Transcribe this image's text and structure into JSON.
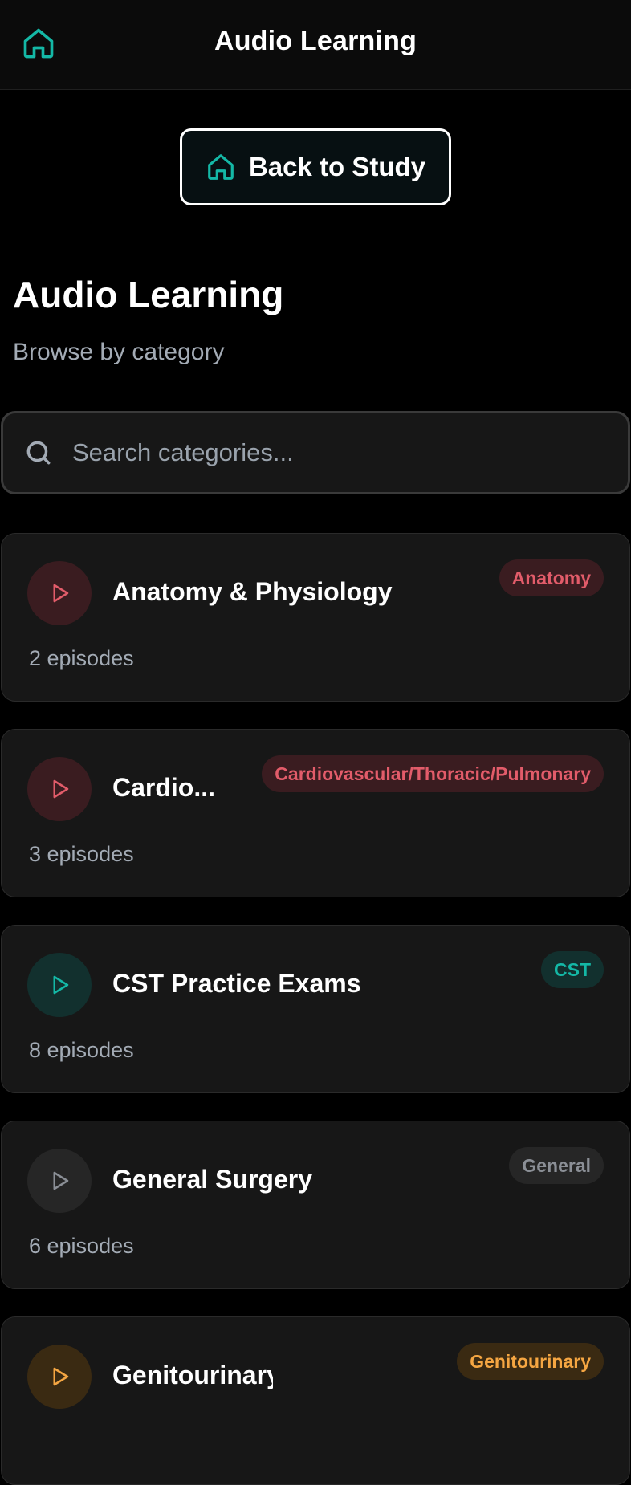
{
  "header": {
    "title": "Audio Learning",
    "home_icon": "home-icon"
  },
  "back_button": {
    "label": "Back to Study",
    "icon": "home-icon"
  },
  "page": {
    "title": "Audio Learning",
    "subtitle": "Browse by category"
  },
  "search": {
    "placeholder": "Search categories...",
    "value": ""
  },
  "colors": {
    "accent_teal": "#14b8a6",
    "red": "#e25c6a",
    "gray": "#8b8f96",
    "orange": "#f5a642",
    "card_bg": "#171717"
  },
  "categories": [
    {
      "name": "Anatomy & Physiology",
      "episodes": "2 episodes",
      "badge": "Anatomy",
      "tone": "red"
    },
    {
      "name": "Cardio...",
      "episodes": "3 episodes",
      "badge": "Cardiovascular/Thoracic/Pulmonary",
      "tone": "red"
    },
    {
      "name": "CST Practice Exams",
      "episodes": "8 episodes",
      "badge": "CST",
      "tone": "teal"
    },
    {
      "name": "General Surgery",
      "episodes": "6 episodes",
      "badge": "General",
      "tone": "gray"
    },
    {
      "name": "Genitourinary",
      "episodes": "",
      "badge": "Genitourinary",
      "tone": "orange"
    }
  ]
}
